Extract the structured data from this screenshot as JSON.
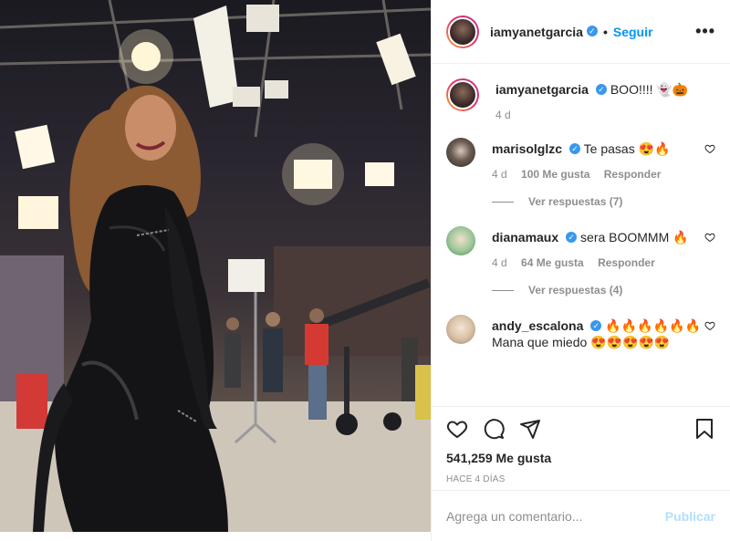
{
  "header": {
    "username": "iamyanetgarcia",
    "verified_glyph": "✓",
    "separator": "•",
    "follow_label": "Seguir",
    "more_label": "•••"
  },
  "caption": {
    "username": "iamyanetgarcia",
    "text": "BOO!!!! 👻🎃",
    "age": "4 d"
  },
  "comments": [
    {
      "username": "marisolglzc",
      "text": "Te pasas 😍🔥",
      "age": "4 d",
      "likes": "100 Me gusta",
      "reply_label": "Responder",
      "view_replies": "Ver respuestas (7)"
    },
    {
      "username": "dianamaux",
      "text": "sera BOOMMM 🔥",
      "age": "4 d",
      "likes": "64 Me gusta",
      "reply_label": "Responder",
      "view_replies": "Ver respuestas (4)"
    },
    {
      "username": "andy_escalona",
      "text": "🔥🔥🔥🔥🔥🔥 Mana que miedo 😍😍😍😍😍"
    }
  ],
  "footer": {
    "likes": "541,259 Me gusta",
    "date": "HACE 4 DÍAS",
    "comment_placeholder": "Agrega un comentario...",
    "publish_label": "Publicar"
  },
  "icons": {
    "like": "heart-icon",
    "comment": "comment-icon",
    "share": "paper-plane-icon",
    "save": "bookmark-icon",
    "more": "more-options-icon"
  },
  "colors": {
    "follow": "#0095f6",
    "verified": "#3897f0",
    "publish_disabled": "#b2dffc",
    "muted": "#8e8e8e"
  }
}
